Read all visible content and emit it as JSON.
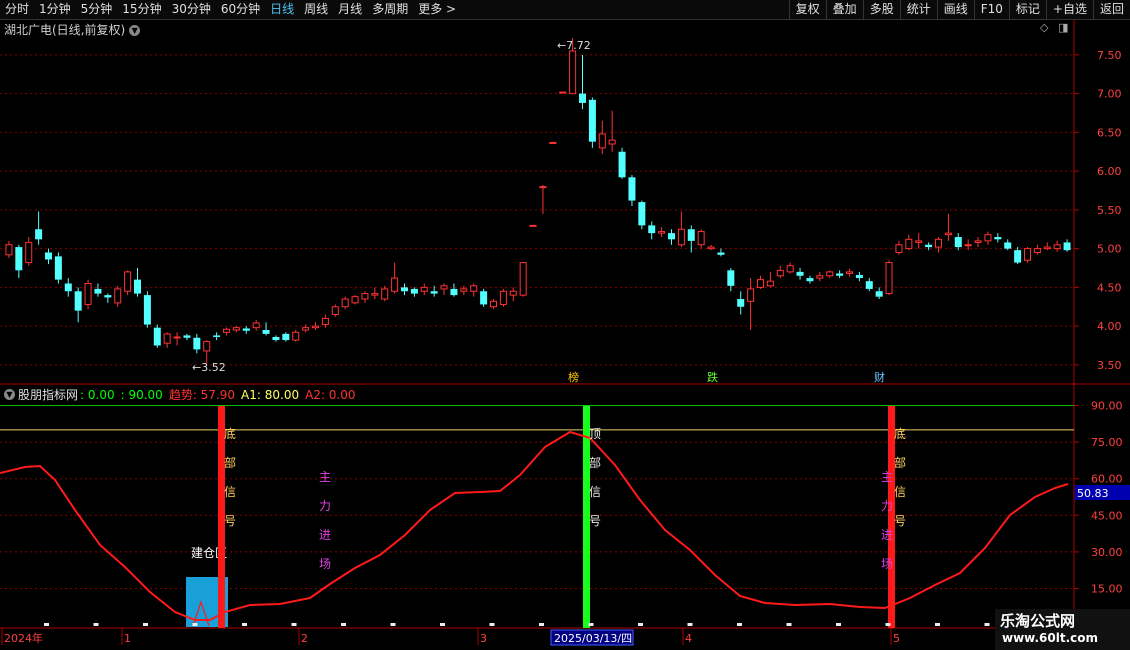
{
  "toolbar": {
    "periods": [
      "分时",
      "1分钟",
      "5分钟",
      "15分钟",
      "30分钟",
      "60分钟",
      "日线",
      "周线",
      "月线",
      "多周期",
      "更多 >"
    ],
    "active_period": "日线",
    "actions": [
      "复权",
      "叠加",
      "多股",
      "统计",
      "画线",
      "F10",
      "标记",
      "+自选",
      "返回"
    ]
  },
  "title": {
    "text": "湖北广电(日线,前复权)"
  },
  "main_chart": {
    "price_ticks": [
      "7.50",
      "7.00",
      "6.50",
      "6.00",
      "5.50",
      "5.00",
      "4.50",
      "4.00",
      "3.50"
    ],
    "high_label": "7.72",
    "low_label": "3.52",
    "markers": [
      "榜",
      "跌",
      "财"
    ],
    "colors": {
      "up": "#ff3333",
      "down": "#54ffff",
      "grid": "#8b0000"
    }
  },
  "indicator": {
    "name": "股朋指标网",
    "values": [
      {
        "text": ": 0.00",
        "color": "#00ff00"
      },
      {
        "text": ": 90.00",
        "color": "#00ff00"
      },
      {
        "text": "趋势: 57.90",
        "color": "#ff3333"
      },
      {
        "text": "A1: 80.00",
        "color": "#ffff66"
      },
      {
        "text": "A2: 0.00",
        "color": "#ff3333"
      }
    ],
    "ticks": [
      "90.00",
      "75.00",
      "60.00",
      "45.00",
      "30.00",
      "15.00"
    ],
    "current_value": "50.83",
    "labels": {
      "bottom_signal": [
        "底",
        "部",
        "信",
        "号"
      ],
      "top_signal": [
        "顶",
        "部",
        "信",
        "号"
      ],
      "main_force": [
        "主",
        "力",
        "进",
        "场"
      ],
      "build_zone": "建仓区"
    }
  },
  "x_axis": {
    "labels": [
      "2024年",
      "1",
      "2",
      "3",
      "2025/03/13/四",
      "4",
      "5"
    ]
  },
  "watermark": {
    "line1": "乐淘公式网",
    "line2": "www.60lt.com"
  }
}
